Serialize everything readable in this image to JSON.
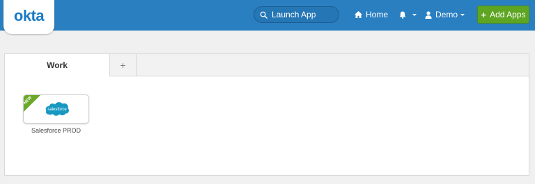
{
  "header": {
    "logo_text": "okta",
    "search_placeholder": "Launch App",
    "home_label": "Home",
    "user_label": "Demo",
    "add_apps_label": "Add Apps"
  },
  "tabs": {
    "active_label": "Work",
    "add_label": "+"
  },
  "apps": [
    {
      "label": "Salesforce PROD",
      "logo_text": "salesforce",
      "badge": "NEW"
    }
  ],
  "colors": {
    "header_bg": "#2a7fc1",
    "add_button_bg": "#5ea522",
    "salesforce_blue": "#1798c1"
  }
}
